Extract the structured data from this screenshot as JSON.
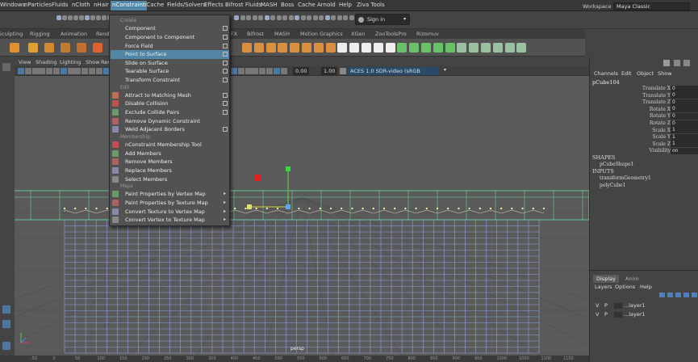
{
  "menubar": {
    "items": [
      "Windows",
      "nParticles",
      "Fluids",
      "nCloth",
      "nHair",
      "nConstraint",
      "nCache",
      "Fields/Solvers",
      "Effects",
      "Bifrost Fluids",
      "MASH",
      "Boss",
      "Cache",
      "Arnold",
      "Help",
      "Ziva Tools"
    ],
    "active": "nConstraint",
    "workspace_label": "Workspace :",
    "workspace_value": "Maya Classic"
  },
  "signin": {
    "label": "Sign in"
  },
  "shelf_tabs": [
    "Sculpting",
    "Rigging",
    "Animation",
    "Rend",
    "FX",
    "Bifrost",
    "MASH",
    "Motion Graphics",
    "XGen",
    "ZooToolsPro",
    "Rizomuv"
  ],
  "viewport_menu": [
    "View",
    "Shading",
    "Lighting",
    "Show",
    "Rend"
  ],
  "viewport_toolbar": {
    "value_a": "0.00",
    "value_b": "1.00",
    "colorspace": "ACES 1.0 SDR-video (sRGB"
  },
  "camera_label": "persp",
  "nconstraint_menu": {
    "sections": [
      {
        "header": "Create",
        "items": [
          {
            "label": "Component",
            "option": true,
            "arrow": false
          },
          {
            "label": "Component to Component",
            "option": true,
            "arrow": false
          },
          {
            "label": "Force Field",
            "option": true,
            "arrow": false
          },
          {
            "label": "Point to Surface",
            "option": true,
            "arrow": false,
            "highlighted": true
          },
          {
            "label": "Slide on Surface",
            "option": true,
            "arrow": false
          },
          {
            "label": "Tearable Surface",
            "option": true,
            "arrow": false
          },
          {
            "label": "Transform Constraint",
            "option": true,
            "arrow": false
          }
        ]
      },
      {
        "header": "Edit",
        "items": [
          {
            "label": "Attract to Matching Mesh",
            "option": true,
            "arrow": false
          },
          {
            "label": "Disable Collision",
            "option": true,
            "arrow": false
          },
          {
            "label": "Exclude Collide Pairs",
            "option": true,
            "arrow": false
          },
          {
            "label": "Remove Dynamic Constraint",
            "option": false,
            "arrow": false
          },
          {
            "label": "Weld Adjacent Borders",
            "option": true,
            "arrow": false
          }
        ]
      },
      {
        "header": "Membership",
        "items": [
          {
            "label": "nConstraint Membership Tool",
            "option": false,
            "arrow": false
          },
          {
            "label": "Add Members",
            "option": false,
            "arrow": false
          },
          {
            "label": "Remove Members",
            "option": false,
            "arrow": false
          },
          {
            "label": "Replace Members",
            "option": false,
            "arrow": false
          },
          {
            "label": "Select Members",
            "option": false,
            "arrow": false
          }
        ]
      },
      {
        "header": "Maps",
        "items": [
          {
            "label": "Paint Properties by Vertex Map",
            "option": false,
            "arrow": true
          },
          {
            "label": "Paint Properties by Texture Map",
            "option": false,
            "arrow": true
          },
          {
            "label": "Convert Texture to Vertex Map",
            "option": false,
            "arrow": true
          },
          {
            "label": "Convert Vertex to Texture Map",
            "option": false,
            "arrow": true
          }
        ]
      }
    ]
  },
  "channel_box": {
    "menu": [
      "Channels",
      "Edit",
      "Object",
      "Show"
    ],
    "object": "pCube104",
    "channels": [
      {
        "name": "Translate X",
        "value": "0"
      },
      {
        "name": "Translate Y",
        "value": "0"
      },
      {
        "name": "Translate Z",
        "value": "0"
      },
      {
        "name": "Rotate X",
        "value": "0"
      },
      {
        "name": "Rotate Y",
        "value": "0"
      },
      {
        "name": "Rotate Z",
        "value": "0"
      },
      {
        "name": "Scale X",
        "value": "1"
      },
      {
        "name": "Scale Y",
        "value": "1"
      },
      {
        "name": "Scale Z",
        "value": "1"
      },
      {
        "name": "Visibility",
        "value": "on"
      }
    ],
    "shapes_header": "SHAPES",
    "shape": "pCubeShape1",
    "inputs_header": "INPUTS",
    "inputs": [
      "transformGeometry1",
      "polyCube1"
    ]
  },
  "layer_editor": {
    "tabs": [
      "Display",
      "Anim"
    ],
    "menu": [
      "Layers",
      "Options",
      "Help"
    ],
    "layers": [
      {
        "v": "V",
        "p": "P",
        "name": "...layer1"
      },
      {
        "v": "V",
        "p": "P",
        "name": "...layer1"
      }
    ]
  },
  "ruler_ticks": [
    "-50",
    "0",
    "50",
    "100",
    "150",
    "200",
    "250",
    "300",
    "350",
    "400",
    "450",
    "500",
    "550",
    "600",
    "650",
    "700",
    "750",
    "800",
    "850",
    "900",
    "950",
    "1000",
    "1050",
    "1100",
    "1150"
  ],
  "colors": {
    "accent": "#5285a6",
    "wire": "#8ea0e0",
    "selected_wire": "#66e0a0"
  }
}
